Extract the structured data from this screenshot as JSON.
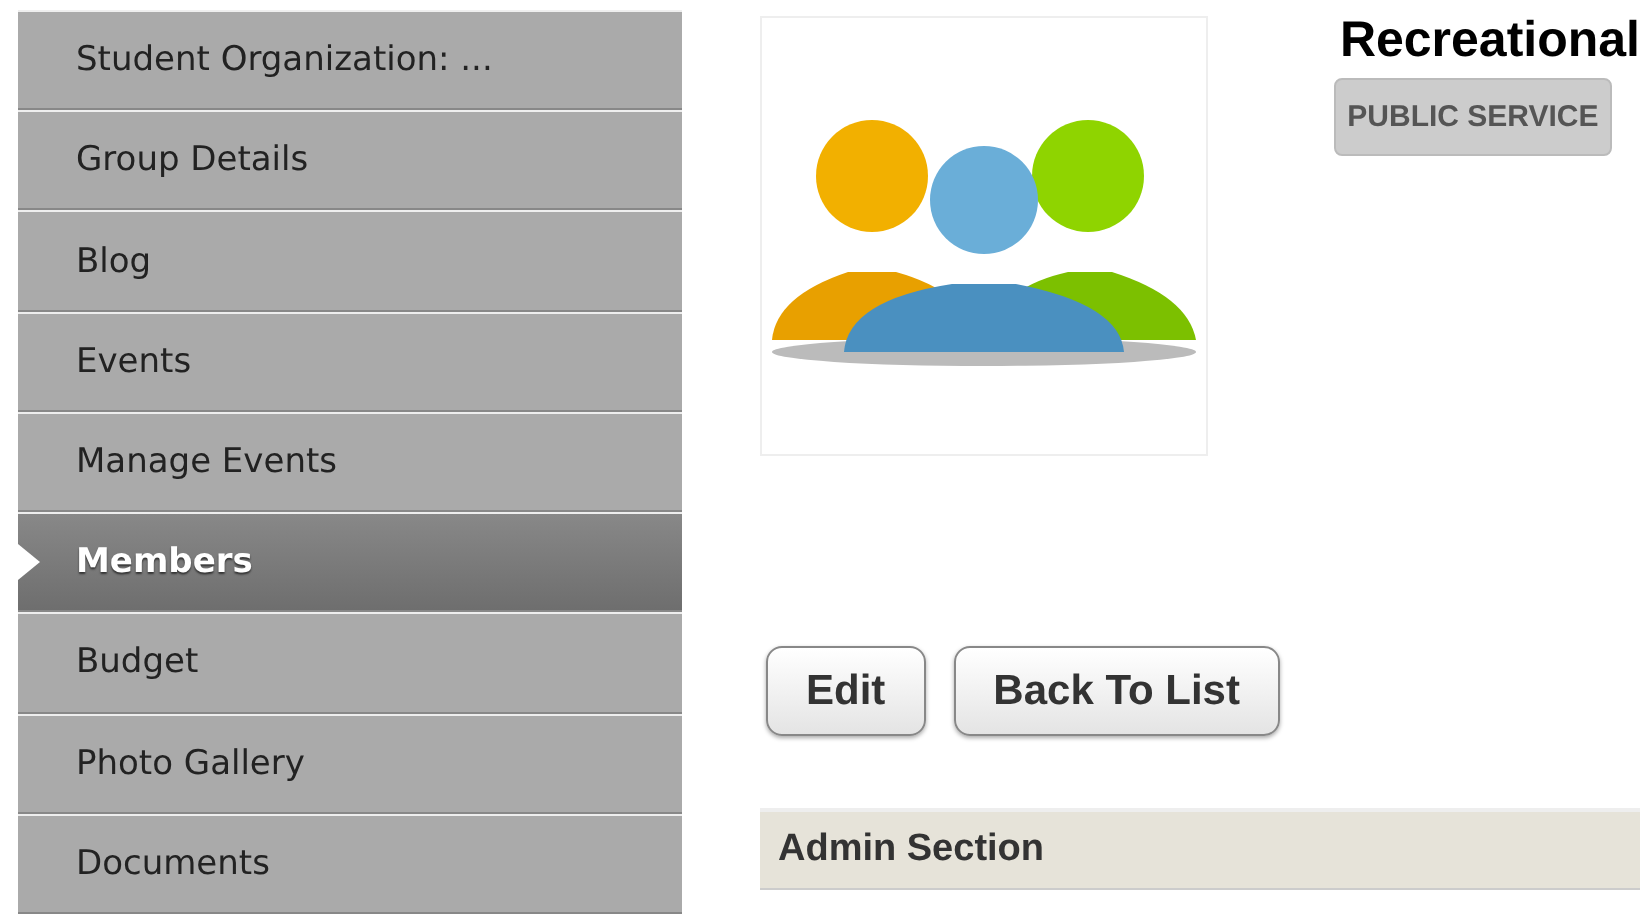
{
  "sidebar": {
    "items": [
      {
        "label": "Student Organization: ...",
        "selected": false
      },
      {
        "label": "Group Details",
        "selected": false
      },
      {
        "label": "Blog",
        "selected": false
      },
      {
        "label": "Events",
        "selected": false
      },
      {
        "label": "Manage Events",
        "selected": false
      },
      {
        "label": "Members",
        "selected": true
      },
      {
        "label": "Budget",
        "selected": false
      },
      {
        "label": "Photo Gallery",
        "selected": false
      },
      {
        "label": "Documents",
        "selected": false
      }
    ]
  },
  "group": {
    "title": "Recreational",
    "category": "PUBLIC SERVICE"
  },
  "buttons": [
    "Edit",
    "Back To List"
  ],
  "section": {
    "title": "Admin Section"
  }
}
